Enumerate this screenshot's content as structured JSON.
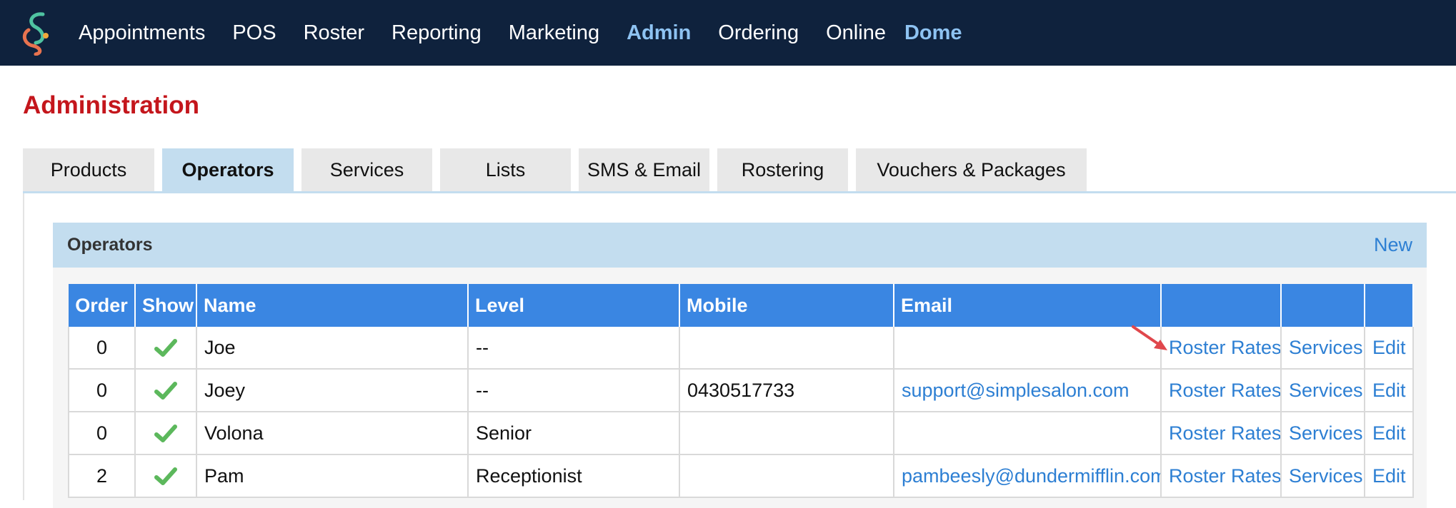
{
  "nav": {
    "items": [
      {
        "label": "Appointments",
        "active": false
      },
      {
        "label": "POS",
        "active": false
      },
      {
        "label": "Roster",
        "active": false
      },
      {
        "label": "Reporting",
        "active": false
      },
      {
        "label": "Marketing",
        "active": false
      },
      {
        "label": "Admin",
        "active": true
      },
      {
        "label": "Ordering",
        "active": false
      },
      {
        "label": "Online",
        "active": false
      }
    ],
    "account": "Dome"
  },
  "page": {
    "title": "Administration"
  },
  "tabs": [
    {
      "label": "Products",
      "active": false
    },
    {
      "label": "Operators",
      "active": true
    },
    {
      "label": "Services",
      "active": false
    },
    {
      "label": "Lists",
      "active": false
    },
    {
      "label": "SMS & Email",
      "active": false
    },
    {
      "label": "Rostering",
      "active": false
    },
    {
      "label": "Vouchers & Packages",
      "active": false
    }
  ],
  "panel": {
    "title": "Operators",
    "new_label": "New"
  },
  "table": {
    "headers": [
      "Order",
      "Show",
      "Name",
      "Level",
      "Mobile",
      "Email",
      "",
      "",
      ""
    ],
    "rows": [
      {
        "order": "0",
        "show": "check-icon",
        "name": "Joe",
        "level": "--",
        "mobile": "",
        "email": "",
        "roster_rates": "Roster Rates",
        "services": "Services",
        "edit": "Edit"
      },
      {
        "order": "0",
        "show": "check-icon",
        "name": "Joey",
        "level": "--",
        "mobile": "0430517733",
        "email": "support@simplesalon.com",
        "roster_rates": "Roster Rates",
        "services": "Services",
        "edit": "Edit"
      },
      {
        "order": "0",
        "show": "check-icon",
        "name": "Volona",
        "level": "Senior",
        "mobile": "",
        "email": "",
        "roster_rates": "Roster Rates",
        "services": "Services",
        "edit": "Edit"
      },
      {
        "order": "2",
        "show": "check-icon",
        "name": "Pam",
        "level": "Receptionist",
        "mobile": "",
        "email": "pambeesly@dundermifflin.com",
        "roster_rates": "Roster Rates",
        "services": "Services",
        "edit": "Edit"
      }
    ]
  },
  "colors": {
    "nav_bg": "#0f223d",
    "active_nav": "#8ec3f2",
    "title_red": "#c4161c",
    "header_blue": "#3a86e2",
    "link_blue": "#2d7fd3",
    "panel_blue": "#c3ddef",
    "check_green": "#5cb85c",
    "arrow_red": "#e0474c"
  }
}
